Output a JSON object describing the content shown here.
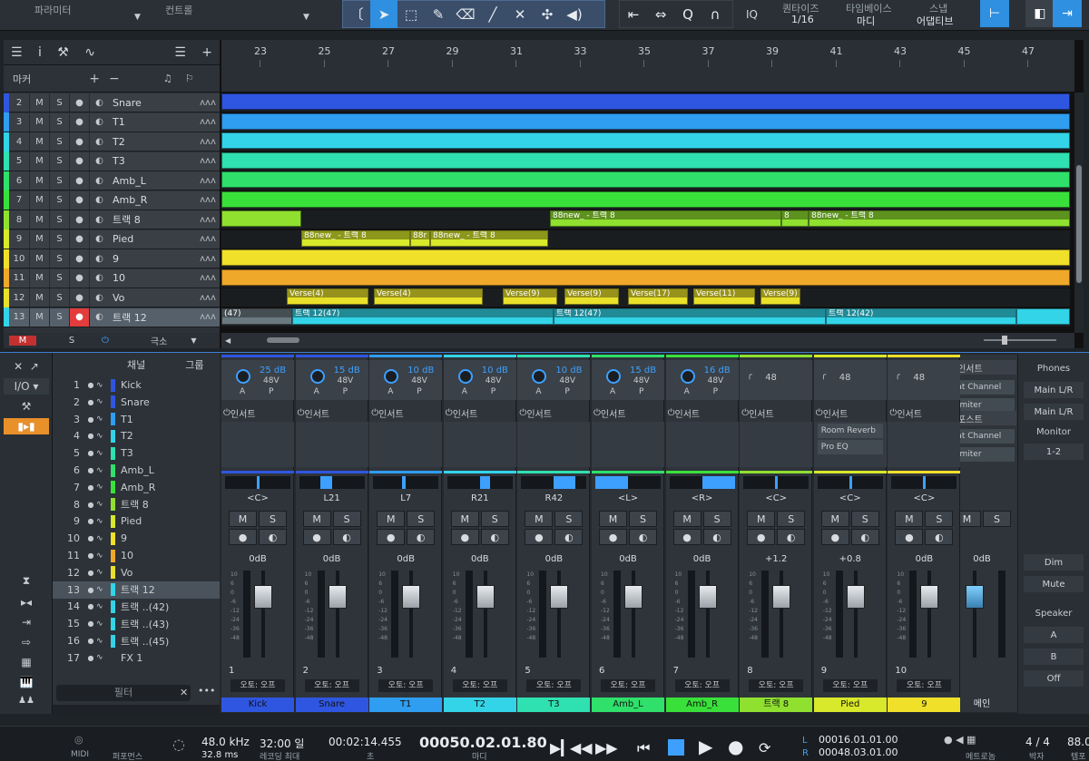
{
  "toolbar": {
    "parameter": "파라미터",
    "control": "컨트롤",
    "iq": "IQ",
    "quantize_label": "퀀타이즈",
    "quantize_value": "1/16",
    "timebase_label": "타임베이스",
    "timebase_value": "마디",
    "snap_label": "스냅",
    "snap_value": "어댑티브"
  },
  "arrange": {
    "marker_label": "마커",
    "ruler": [
      "23",
      "25",
      "27",
      "29",
      "31",
      "33",
      "35",
      "37",
      "39",
      "41",
      "43",
      "45",
      "47"
    ],
    "bottom": {
      "m": "M",
      "s": "S",
      "zoom": "극소"
    }
  },
  "tracks": [
    {
      "num": "2",
      "name": "Snare",
      "color": "#2f56e0"
    },
    {
      "num": "3",
      "name": "T1",
      "color": "#2f9df0"
    },
    {
      "num": "4",
      "name": "T2",
      "color": "#33d4e8"
    },
    {
      "num": "5",
      "name": "T3",
      "color": "#2fe0b0"
    },
    {
      "num": "6",
      "name": "Amb_L",
      "color": "#2fe06a"
    },
    {
      "num": "7",
      "name": "Amb_R",
      "color": "#3ae03a"
    },
    {
      "num": "8",
      "name": "트랙 8",
      "color": "#8fe02f"
    },
    {
      "num": "9",
      "name": "Pied",
      "color": "#d8e82a"
    },
    {
      "num": "10",
      "name": "9",
      "color": "#f0e02a"
    },
    {
      "num": "11",
      "name": "10",
      "color": "#f0a82a"
    },
    {
      "num": "12",
      "name": "Vo",
      "color": "#e8e02a"
    },
    {
      "num": "13",
      "name": "트랙 12",
      "color": "#33d4e8",
      "selected": true
    }
  ],
  "clips": {
    "t8a": "88new_ - 트랙 8",
    "t8b": "8",
    "t8c": "88new_ - 트랙 8",
    "t9a": "88new_ - 트랙 8",
    "t9b": "88r",
    "t9c": "88new_ - 트랙 8",
    "vo1": "Verse(4)",
    "vo2": "Verse(9)",
    "vo3": "Verse(17)",
    "vo4": "Verse(11)",
    "t12a": "(47)",
    "t12b": "트랙 12(47)",
    "t12c": "트랙 12(47)",
    "t12d": "트랙 12(42)"
  },
  "mixer": {
    "left": {
      "io": "I/O"
    },
    "chanlist": {
      "col_channel": "채널",
      "col_group": "그룹",
      "filter": "필터",
      "items": [
        {
          "num": "1",
          "name": "Kick",
          "color": "#2f56e0"
        },
        {
          "num": "2",
          "name": "Snare",
          "color": "#2f56e0"
        },
        {
          "num": "3",
          "name": "T1",
          "color": "#2f9df0"
        },
        {
          "num": "4",
          "name": "T2",
          "color": "#33d4e8"
        },
        {
          "num": "5",
          "name": "T3",
          "color": "#2fe0b0"
        },
        {
          "num": "6",
          "name": "Amb_L",
          "color": "#2fe06a"
        },
        {
          "num": "7",
          "name": "Amb_R",
          "color": "#3ae03a"
        },
        {
          "num": "8",
          "name": "트랙 8",
          "color": "#8fe02f"
        },
        {
          "num": "9",
          "name": "Pied",
          "color": "#d8e82a"
        },
        {
          "num": "10",
          "name": "9",
          "color": "#f0e02a"
        },
        {
          "num": "11",
          "name": "10",
          "color": "#f0a82a"
        },
        {
          "num": "12",
          "name": "Vo",
          "color": "#e8e02a"
        },
        {
          "num": "13",
          "name": "트랙 12",
          "color": "#33d4e8"
        },
        {
          "num": "14",
          "name": "트랙 ..(42)",
          "color": "#33d4e8"
        },
        {
          "num": "15",
          "name": "트랙 ..(43)",
          "color": "#33d4e8"
        },
        {
          "num": "16",
          "name": "트랙 ..(45)",
          "color": "#33d4e8"
        },
        {
          "num": "17",
          "name": "FX 1",
          "color": ""
        }
      ]
    },
    "strips": [
      {
        "gain": "25 dB",
        "pan": "<C>",
        "vol": "0dB",
        "num": "1",
        "name": "Kick",
        "color": "#2f56e0",
        "pan_pos": 0.5
      },
      {
        "gain": "15 dB",
        "pan": "L21",
        "vol": "0dB",
        "num": "2",
        "name": "Snare",
        "color": "#2f56e0",
        "pan_pos": 0.33
      },
      {
        "gain": "10 dB",
        "pan": "L7",
        "vol": "0dB",
        "num": "3",
        "name": "T1",
        "color": "#2f9df0",
        "pan_pos": 0.44
      },
      {
        "gain": "10 dB",
        "pan": "R21",
        "vol": "0dB",
        "num": "4",
        "name": "T2",
        "color": "#33d4e8",
        "pan_pos": 0.66
      },
      {
        "gain": "10 dB",
        "pan": "R42",
        "vol": "0dB",
        "num": "5",
        "name": "T3",
        "color": "#2fe0b0",
        "pan_pos": 0.83
      },
      {
        "gain": "15 dB",
        "pan": "<L>",
        "vol": "0dB",
        "num": "6",
        "name": "Amb_L",
        "color": "#2fe06a",
        "pan_pos": 0
      },
      {
        "gain": "16 dB",
        "pan": "<R>",
        "vol": "0dB",
        "num": "7",
        "name": "Amb_R",
        "color": "#3ae03a",
        "pan_pos": 1
      },
      {
        "gain": "48",
        "pan": "<C>",
        "vol": "+1.2",
        "num": "8",
        "name": "트랙 8",
        "color": "#8fe02f",
        "pan_pos": 0.5
      },
      {
        "gain": "48",
        "pan": "<C>",
        "vol": "+0.8",
        "num": "9",
        "name": "Pied",
        "color": "#d8e82a",
        "pan_pos": 0.5
      },
      {
        "gain": "48",
        "pan": "<C>",
        "vol": "0dB",
        "num": "10",
        "name": "9",
        "color": "#f0e02a",
        "pan_pos": 0.5
      }
    ],
    "phantom": "48V",
    "insert": "인서트",
    "post": "포스트",
    "auto": "오토: 오프",
    "plug_reverb": "Room Reverb",
    "plug_eq": "Pro EQ",
    "plug_fat": "Fat Channel",
    "plug_limiter": "Limiter",
    "main": {
      "vol": "0dB",
      "name": "메인"
    },
    "right": {
      "phones": "Phones",
      "main_lr1": "Main L/R",
      "main_lr2": "Main L/R",
      "monitor": "Monitor",
      "monitor_val": "1-2",
      "dim": "Dim",
      "mute": "Mute",
      "speaker": "Speaker",
      "a": "A",
      "b": "B",
      "off": "Off"
    }
  },
  "transport": {
    "midi": "MIDI",
    "perf": "퍼포먼스",
    "sr": "48.0 kHz",
    "latency": "32.8 ms",
    "rec_days": "32:00 일",
    "rec_max": "레코딩 최대",
    "time": "00:02:14.455",
    "time_lbl": "초",
    "pos": "00050.02.01.80",
    "pos_lbl": "마디",
    "l": "00016.01.01.00",
    "r": "00048.03.01.00",
    "metro": "메트로놈",
    "sig": "4 / 4",
    "sig_lbl": "박자",
    "tempo": "88.0",
    "tempo_lbl": "템포"
  }
}
